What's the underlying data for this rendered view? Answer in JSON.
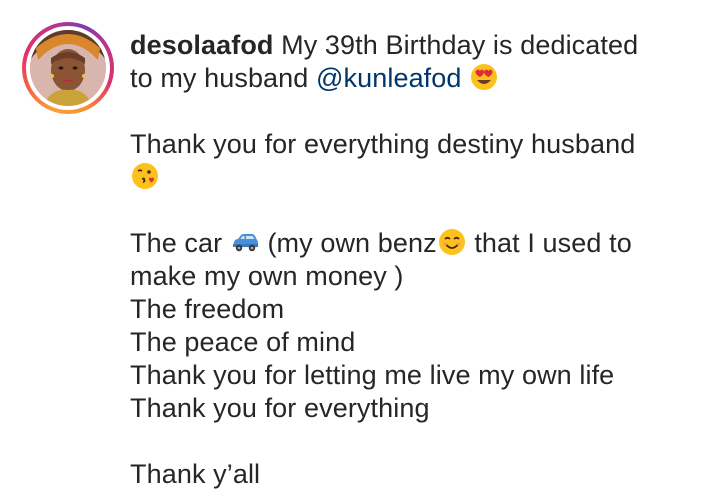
{
  "post": {
    "username": "desolaafod",
    "caption_line1": " My 39th Birthday is dedicated",
    "caption_line2_pre": "to my husband ",
    "mention": "@kunleafod",
    "thanks_line": "Thank you for everything destiny husband",
    "car_pre": "The car ",
    "car_mid": " (my own benz",
    "car_post": " that I used to",
    "money_line": "make my own money )",
    "freedom_line": "The freedom",
    "peace_line": "The peace of mind",
    "life_line": "Thank you for letting me live my own life",
    "everything_line": "Thank you for everything",
    "closing_line": "Thank y’all"
  },
  "icons": {
    "heart_eyes": "heart-eyes-emoji",
    "kiss": "face-blowing-kiss-emoji",
    "car": "car-emoji",
    "smile": "smiling-face-emoji"
  }
}
